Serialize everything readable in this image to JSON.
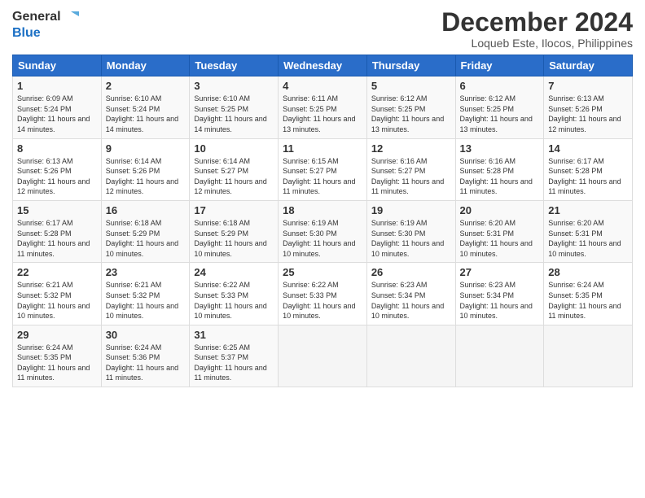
{
  "logo": {
    "text_general": "General",
    "text_blue": "Blue"
  },
  "header": {
    "month": "December 2024",
    "location": "Loqueb Este, Ilocos, Philippines"
  },
  "days_of_week": [
    "Sunday",
    "Monday",
    "Tuesday",
    "Wednesday",
    "Thursday",
    "Friday",
    "Saturday"
  ],
  "weeks": [
    [
      {
        "day": "1",
        "sunrise": "6:09 AM",
        "sunset": "5:24 PM",
        "daylight": "11 hours and 14 minutes."
      },
      {
        "day": "2",
        "sunrise": "6:10 AM",
        "sunset": "5:24 PM",
        "daylight": "11 hours and 14 minutes."
      },
      {
        "day": "3",
        "sunrise": "6:10 AM",
        "sunset": "5:25 PM",
        "daylight": "11 hours and 14 minutes."
      },
      {
        "day": "4",
        "sunrise": "6:11 AM",
        "sunset": "5:25 PM",
        "daylight": "11 hours and 13 minutes."
      },
      {
        "day": "5",
        "sunrise": "6:12 AM",
        "sunset": "5:25 PM",
        "daylight": "11 hours and 13 minutes."
      },
      {
        "day": "6",
        "sunrise": "6:12 AM",
        "sunset": "5:25 PM",
        "daylight": "11 hours and 13 minutes."
      },
      {
        "day": "7",
        "sunrise": "6:13 AM",
        "sunset": "5:26 PM",
        "daylight": "11 hours and 12 minutes."
      }
    ],
    [
      {
        "day": "8",
        "sunrise": "6:13 AM",
        "sunset": "5:26 PM",
        "daylight": "11 hours and 12 minutes."
      },
      {
        "day": "9",
        "sunrise": "6:14 AM",
        "sunset": "5:26 PM",
        "daylight": "11 hours and 12 minutes."
      },
      {
        "day": "10",
        "sunrise": "6:14 AM",
        "sunset": "5:27 PM",
        "daylight": "11 hours and 12 minutes."
      },
      {
        "day": "11",
        "sunrise": "6:15 AM",
        "sunset": "5:27 PM",
        "daylight": "11 hours and 11 minutes."
      },
      {
        "day": "12",
        "sunrise": "6:16 AM",
        "sunset": "5:27 PM",
        "daylight": "11 hours and 11 minutes."
      },
      {
        "day": "13",
        "sunrise": "6:16 AM",
        "sunset": "5:28 PM",
        "daylight": "11 hours and 11 minutes."
      },
      {
        "day": "14",
        "sunrise": "6:17 AM",
        "sunset": "5:28 PM",
        "daylight": "11 hours and 11 minutes."
      }
    ],
    [
      {
        "day": "15",
        "sunrise": "6:17 AM",
        "sunset": "5:28 PM",
        "daylight": "11 hours and 11 minutes."
      },
      {
        "day": "16",
        "sunrise": "6:18 AM",
        "sunset": "5:29 PM",
        "daylight": "11 hours and 10 minutes."
      },
      {
        "day": "17",
        "sunrise": "6:18 AM",
        "sunset": "5:29 PM",
        "daylight": "11 hours and 10 minutes."
      },
      {
        "day": "18",
        "sunrise": "6:19 AM",
        "sunset": "5:30 PM",
        "daylight": "11 hours and 10 minutes."
      },
      {
        "day": "19",
        "sunrise": "6:19 AM",
        "sunset": "5:30 PM",
        "daylight": "11 hours and 10 minutes."
      },
      {
        "day": "20",
        "sunrise": "6:20 AM",
        "sunset": "5:31 PM",
        "daylight": "11 hours and 10 minutes."
      },
      {
        "day": "21",
        "sunrise": "6:20 AM",
        "sunset": "5:31 PM",
        "daylight": "11 hours and 10 minutes."
      }
    ],
    [
      {
        "day": "22",
        "sunrise": "6:21 AM",
        "sunset": "5:32 PM",
        "daylight": "11 hours and 10 minutes."
      },
      {
        "day": "23",
        "sunrise": "6:21 AM",
        "sunset": "5:32 PM",
        "daylight": "11 hours and 10 minutes."
      },
      {
        "day": "24",
        "sunrise": "6:22 AM",
        "sunset": "5:33 PM",
        "daylight": "11 hours and 10 minutes."
      },
      {
        "day": "25",
        "sunrise": "6:22 AM",
        "sunset": "5:33 PM",
        "daylight": "11 hours and 10 minutes."
      },
      {
        "day": "26",
        "sunrise": "6:23 AM",
        "sunset": "5:34 PM",
        "daylight": "11 hours and 10 minutes."
      },
      {
        "day": "27",
        "sunrise": "6:23 AM",
        "sunset": "5:34 PM",
        "daylight": "11 hours and 10 minutes."
      },
      {
        "day": "28",
        "sunrise": "6:24 AM",
        "sunset": "5:35 PM",
        "daylight": "11 hours and 11 minutes."
      }
    ],
    [
      {
        "day": "29",
        "sunrise": "6:24 AM",
        "sunset": "5:35 PM",
        "daylight": "11 hours and 11 minutes."
      },
      {
        "day": "30",
        "sunrise": "6:24 AM",
        "sunset": "5:36 PM",
        "daylight": "11 hours and 11 minutes."
      },
      {
        "day": "31",
        "sunrise": "6:25 AM",
        "sunset": "5:37 PM",
        "daylight": "11 hours and 11 minutes."
      },
      null,
      null,
      null,
      null
    ]
  ],
  "labels": {
    "sunrise": "Sunrise:",
    "sunset": "Sunset:",
    "daylight": "Daylight:"
  }
}
